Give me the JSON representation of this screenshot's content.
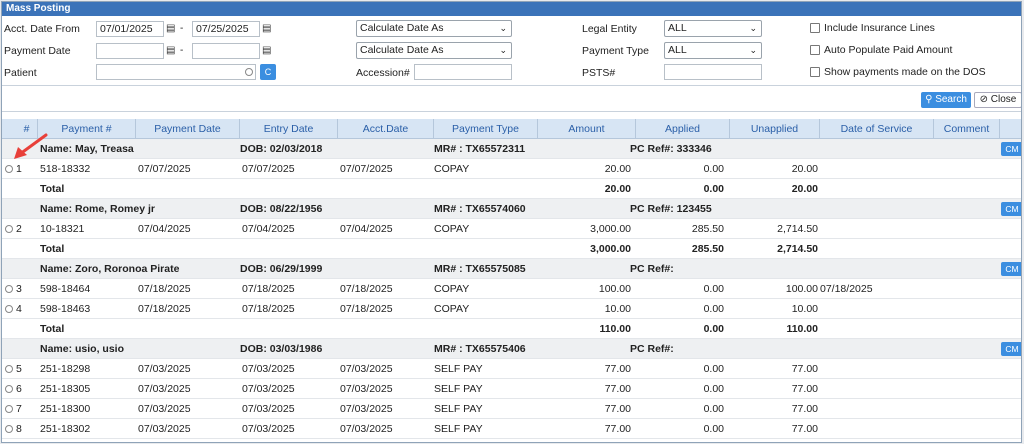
{
  "window": {
    "title": "Mass Posting"
  },
  "filters": {
    "acct_date_from": {
      "label": "Acct. Date From",
      "from": "07/01/2025",
      "to": "07/25/2025",
      "dash": "-"
    },
    "payment_date": {
      "label": "Payment Date",
      "from": "",
      "to": "",
      "dash": "-"
    },
    "patient": {
      "label": "Patient",
      "value": "",
      "button": "C"
    },
    "calc_date_1": "Calculate Date As",
    "calc_date_2": "Calculate Date As",
    "accession": {
      "label": "Accession#",
      "value": ""
    },
    "legal_entity": {
      "label": "Legal Entity",
      "value": "ALL"
    },
    "payment_type": {
      "label": "Payment Type",
      "value": "ALL"
    },
    "psts": {
      "label": "PSTS#",
      "value": ""
    },
    "checkboxes": [
      {
        "label": "Include Insurance Lines",
        "checked": false
      },
      {
        "label": "Auto Populate Paid Amount",
        "checked": false
      },
      {
        "label": "Show payments made on the DOS",
        "checked": false
      }
    ]
  },
  "actions": {
    "search": "Search",
    "close": "Close"
  },
  "columns": [
    "#",
    "Payment #",
    "Payment Date",
    "Entry Date",
    "Acct.Date",
    "Payment Type",
    "Amount",
    "Applied",
    "Unapplied",
    "Date of Service",
    "Comment"
  ],
  "cm_label": "CM",
  "total_label": "Total",
  "groups": [
    {
      "name": "Name: May, Treasa",
      "dob": "DOB: 02/03/2018",
      "mr": "MR# : TX65572311",
      "pcref": "PC Ref#: 333346",
      "rows": [
        {
          "num": "1",
          "payment": "518-18332",
          "payment_date": "07/07/2025",
          "entry_date": "07/07/2025",
          "acct_date": "07/07/2025",
          "type": "COPAY",
          "amount": "20.00",
          "applied": "0.00",
          "unapplied": "20.00",
          "dos": ""
        }
      ],
      "total": {
        "amount": "20.00",
        "applied": "0.00",
        "unapplied": "20.00"
      }
    },
    {
      "name": "Name: Rome, Romey jr",
      "dob": "DOB: 08/22/1956",
      "mr": "MR# : TX65574060",
      "pcref": "PC Ref#: 123455",
      "rows": [
        {
          "num": "2",
          "payment": "10-18321",
          "payment_date": "07/04/2025",
          "entry_date": "07/04/2025",
          "acct_date": "07/04/2025",
          "type": "COPAY",
          "amount": "3,000.00",
          "applied": "285.50",
          "unapplied": "2,714.50",
          "dos": ""
        }
      ],
      "total": {
        "amount": "3,000.00",
        "applied": "285.50",
        "unapplied": "2,714.50"
      }
    },
    {
      "name": "Name: Zoro, Roronoa Pirate",
      "dob": "DOB: 06/29/1999",
      "mr": "MR# : TX65575085",
      "pcref": "PC Ref#:",
      "rows": [
        {
          "num": "3",
          "payment": "598-18464",
          "payment_date": "07/18/2025",
          "entry_date": "07/18/2025",
          "acct_date": "07/18/2025",
          "type": "COPAY",
          "amount": "100.00",
          "applied": "0.00",
          "unapplied": "100.00",
          "dos": "07/18/2025"
        },
        {
          "num": "4",
          "payment": "598-18463",
          "payment_date": "07/18/2025",
          "entry_date": "07/18/2025",
          "acct_date": "07/18/2025",
          "type": "COPAY",
          "amount": "10.00",
          "applied": "0.00",
          "unapplied": "10.00",
          "dos": ""
        }
      ],
      "total": {
        "amount": "110.00",
        "applied": "0.00",
        "unapplied": "110.00"
      }
    },
    {
      "name": "Name: usio, usio",
      "dob": "DOB: 03/03/1986",
      "mr": "MR# : TX65575406",
      "pcref": "PC Ref#:",
      "rows": [
        {
          "num": "5",
          "payment": "251-18298",
          "payment_date": "07/03/2025",
          "entry_date": "07/03/2025",
          "acct_date": "07/03/2025",
          "type": "SELF PAY",
          "amount": "77.00",
          "applied": "0.00",
          "unapplied": "77.00",
          "dos": ""
        },
        {
          "num": "6",
          "payment": "251-18305",
          "payment_date": "07/03/2025",
          "entry_date": "07/03/2025",
          "acct_date": "07/03/2025",
          "type": "SELF PAY",
          "amount": "77.00",
          "applied": "0.00",
          "unapplied": "77.00",
          "dos": ""
        },
        {
          "num": "7",
          "payment": "251-18300",
          "payment_date": "07/03/2025",
          "entry_date": "07/03/2025",
          "acct_date": "07/03/2025",
          "type": "SELF PAY",
          "amount": "77.00",
          "applied": "0.00",
          "unapplied": "77.00",
          "dos": ""
        },
        {
          "num": "8",
          "payment": "251-18302",
          "payment_date": "07/03/2025",
          "entry_date": "07/03/2025",
          "acct_date": "07/03/2025",
          "type": "SELF PAY",
          "amount": "77.00",
          "applied": "0.00",
          "unapplied": "77.00",
          "dos": ""
        }
      ],
      "total": null
    }
  ],
  "colors": {
    "header_bar": "#3b73b9",
    "button": "#3b8ee0",
    "grid_header": "#d7e5f4",
    "arrow": "#e8403a"
  },
  "icons": {
    "calendar": "calendar-icon",
    "search": "search-icon",
    "close": "close-icon",
    "clear": "clear-circle-icon",
    "annotation": "red-arrow-icon"
  }
}
